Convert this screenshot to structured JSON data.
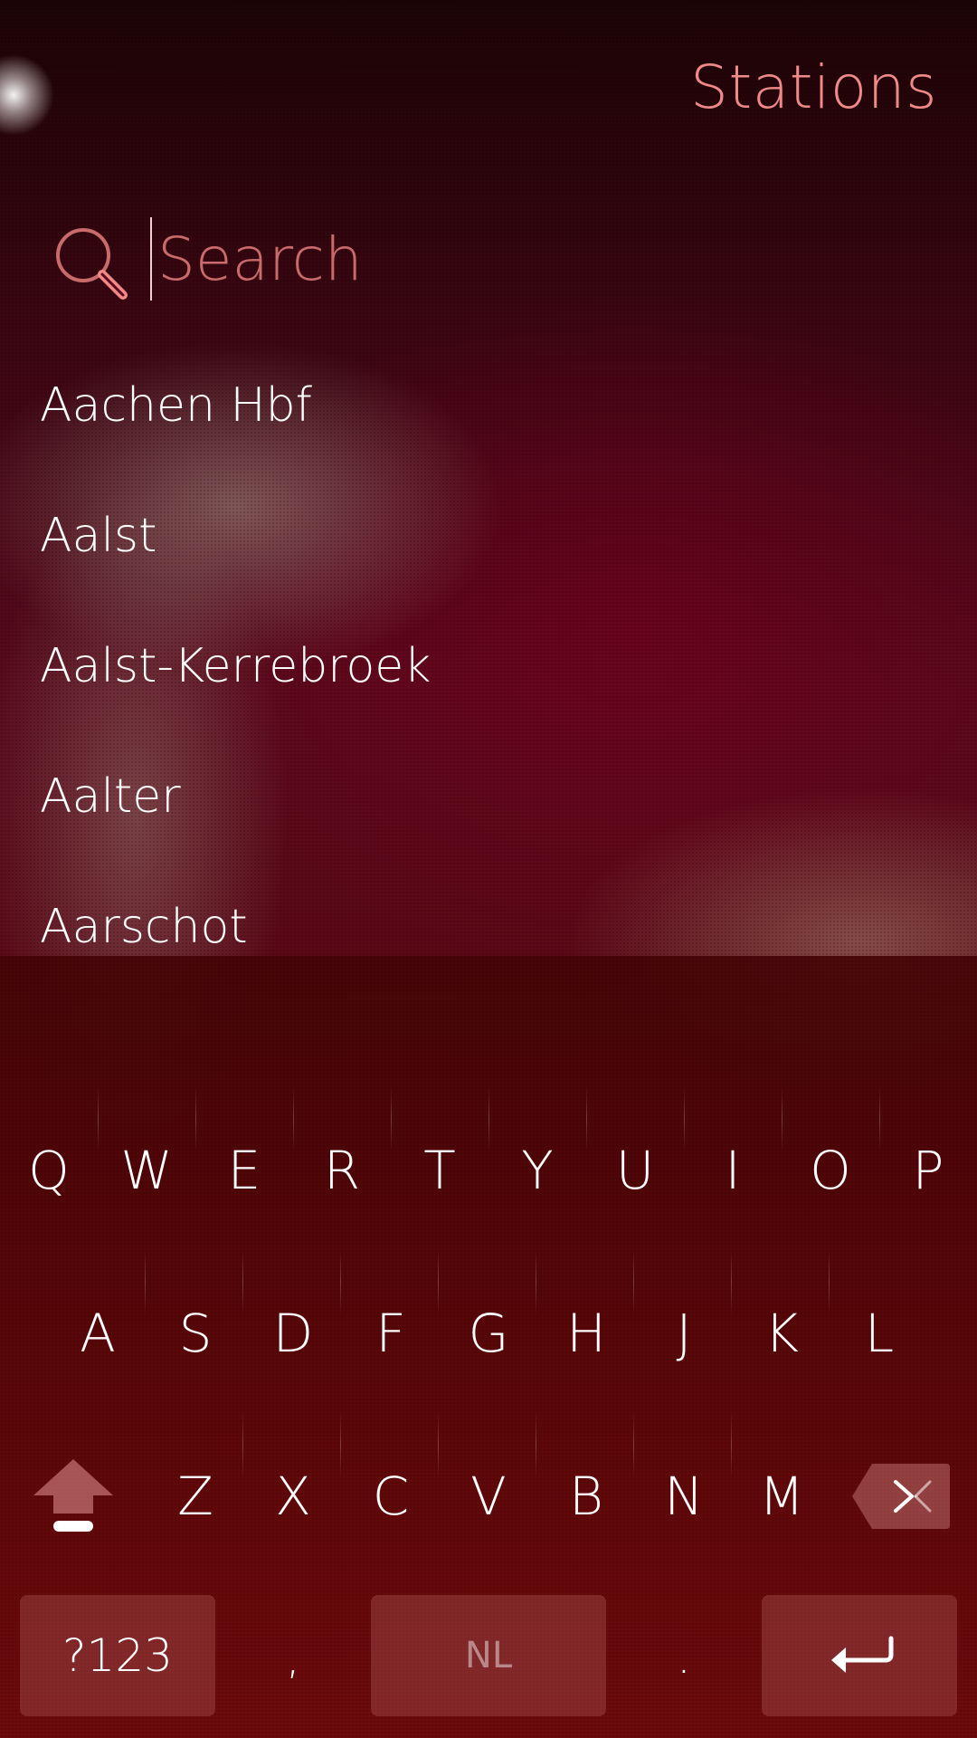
{
  "header": {
    "title": "Stations"
  },
  "search": {
    "placeholder": "Search",
    "value": ""
  },
  "stations": [
    "Aachen Hbf",
    "Aalst",
    "Aalst-Kerrebroek",
    "Aalter",
    "Aarschot"
  ],
  "keyboard": {
    "row1": [
      "Q",
      "W",
      "E",
      "R",
      "T",
      "Y",
      "U",
      "I",
      "O",
      "P"
    ],
    "row2": [
      "A",
      "S",
      "D",
      "F",
      "G",
      "H",
      "J",
      "K",
      "L"
    ],
    "row3": [
      "Z",
      "X",
      "C",
      "V",
      "B",
      "N",
      "M"
    ],
    "symbols_label": "?123",
    "comma_label": ",",
    "space_label": "NL",
    "period_label": "."
  },
  "colors": {
    "accent": "#f08a88",
    "placeholder": "#c96a6b",
    "key_fill": "#a85050"
  }
}
